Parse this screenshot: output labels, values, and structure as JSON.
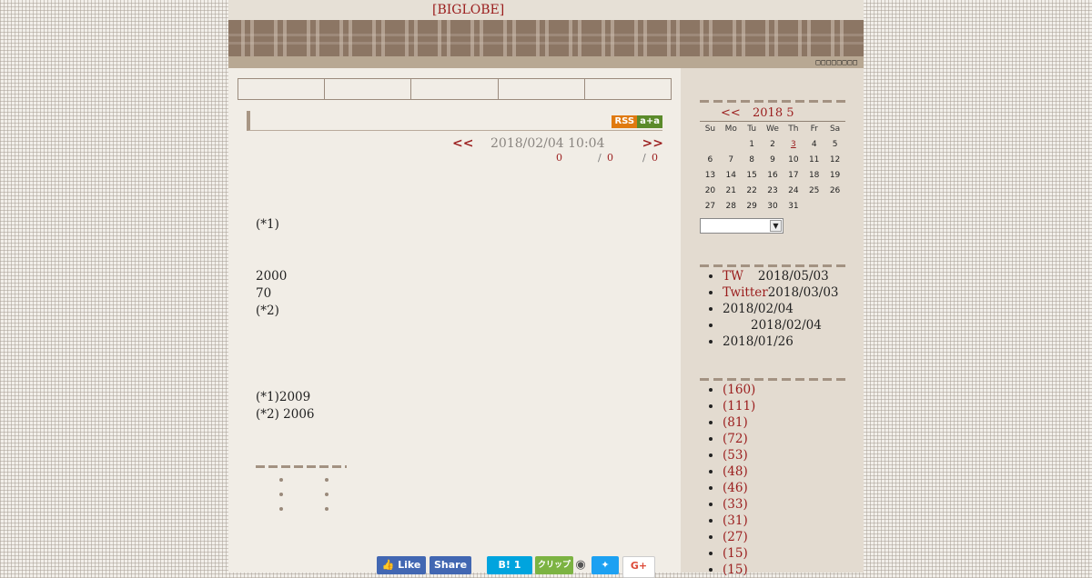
{
  "header": {
    "site_link": "[BIGLOBE]",
    "tiny_text": "□□□□□□□□"
  },
  "main": {
    "rss": {
      "left": "RSS",
      "right": "a+a"
    },
    "nav": {
      "prev": "<<",
      "date": "2018/02/04 10:04",
      "next": ">>"
    },
    "counts": [
      "0",
      "/",
      "0",
      "/",
      "0"
    ],
    "paragraphs": [
      {
        "lines": [
          "(*1)"
        ]
      },
      {
        "lines": [
          "2000",
          "70",
          "(*2)"
        ]
      },
      {
        "lines": [
          "(*1)2009",
          "(*2) 2006"
        ]
      }
    ],
    "social": {
      "like": "Like",
      "share": "Share",
      "hatena": "B! 1",
      "clip": "クリップ",
      "gplus": "G+"
    }
  },
  "sidebar": {
    "calendar": {
      "prev": "<<",
      "title": "2018 5",
      "weekdays": [
        "Su",
        "Mo",
        "Tu",
        "We",
        "Th",
        "Fr",
        "Sa"
      ],
      "weeks": [
        [
          "",
          "",
          "1",
          "2",
          "3",
          "4",
          "5"
        ],
        [
          "6",
          "7",
          "8",
          "9",
          "10",
          "11",
          "12"
        ],
        [
          "13",
          "14",
          "15",
          "16",
          "17",
          "18",
          "19"
        ],
        [
          "20",
          "21",
          "22",
          "23",
          "24",
          "25",
          "26"
        ],
        [
          "27",
          "28",
          "29",
          "30",
          "31",
          "",
          ""
        ]
      ],
      "linked_day": "3"
    },
    "recent": [
      {
        "prefix": "TW",
        "date": "2018/05/03"
      },
      {
        "prefix": "Twitter",
        "date": "2018/03/03"
      },
      {
        "prefix": "",
        "date": "2018/02/04"
      },
      {
        "prefix": "",
        "date": "2018/02/04"
      },
      {
        "prefix": "",
        "date": "2018/01/26"
      }
    ],
    "categories": [
      "(160)",
      "(111)",
      "(81)",
      "(72)",
      "(53)",
      "(48)",
      "(46)",
      "(33)",
      "(31)",
      "(27)",
      "(15)",
      "(15)"
    ]
  }
}
